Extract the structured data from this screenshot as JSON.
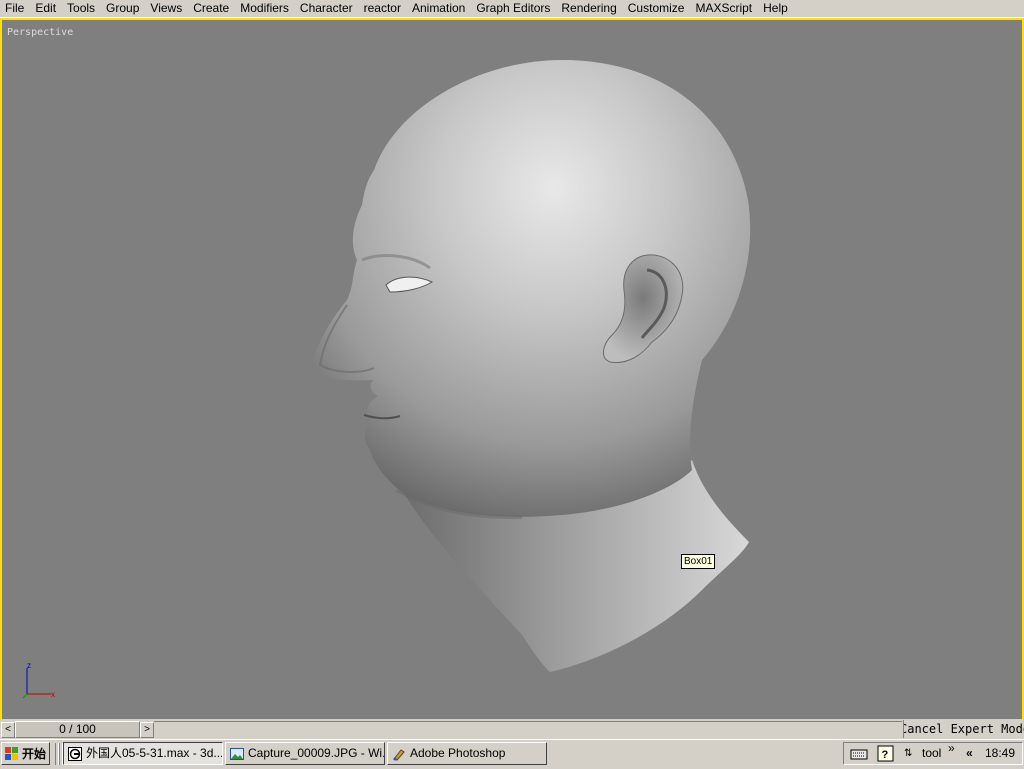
{
  "menu": [
    "File",
    "Edit",
    "Tools",
    "Group",
    "Views",
    "Create",
    "Modifiers",
    "Character",
    "reactor",
    "Animation",
    "Graph Editors",
    "Rendering",
    "Customize",
    "MAXScript",
    "Help"
  ],
  "viewport": {
    "label": "Perspective",
    "tooltip": "Box01",
    "axis_z": "z",
    "axis_x": "x",
    "border_color": "#ffe000",
    "background": "#7f7f7f"
  },
  "timeslider": {
    "prev": "<",
    "position": "0 / 100",
    "next": ">",
    "status_text": "Cancel Expert Mode"
  },
  "taskbar": {
    "start_label": "开始",
    "tasks": [
      {
        "label": "外国人05-5-31.max - 3d...",
        "icon": "3dsmax-icon",
        "active": true
      },
      {
        "label": "Capture_00009.JPG - Wi...",
        "icon": "image-viewer-icon",
        "active": false
      },
      {
        "label": "Adobe Photoshop",
        "icon": "photoshop-icon",
        "active": false
      }
    ],
    "tray": {
      "keyboard_icon": "keyboard-icon",
      "help_icon": "help-icon",
      "language_toggle": "⇅",
      "toolbar_label": "tool",
      "toolbar_chevron": "»",
      "expand_chevron": "«",
      "clock": "18:49"
    }
  }
}
